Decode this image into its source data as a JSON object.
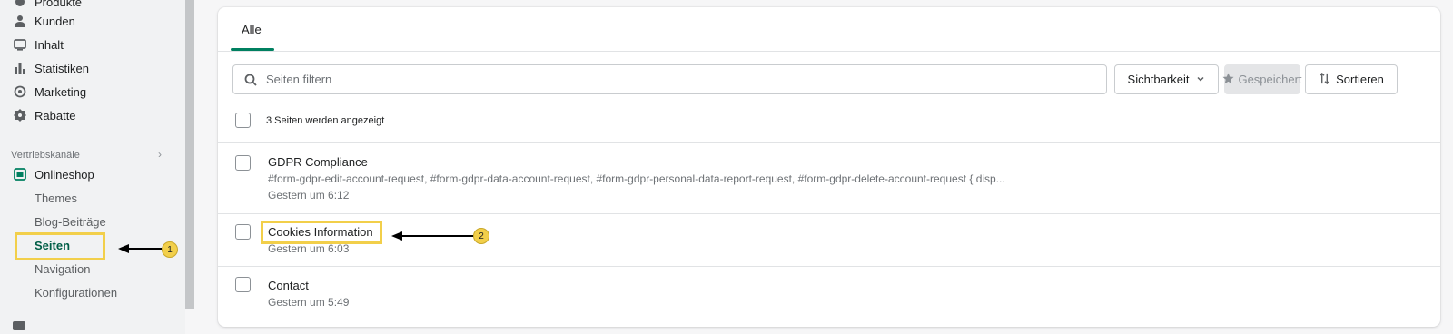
{
  "sidebar": {
    "items": [
      {
        "label": "Produkte",
        "icon": "tag-icon"
      },
      {
        "label": "Kunden",
        "icon": "person-icon"
      },
      {
        "label": "Inhalt",
        "icon": "content-icon"
      },
      {
        "label": "Statistiken",
        "icon": "bar-chart-icon"
      },
      {
        "label": "Marketing",
        "icon": "target-icon"
      },
      {
        "label": "Rabatte",
        "icon": "discount-icon"
      }
    ],
    "section_title": "Vertriebskanäle",
    "channel": {
      "label": "Onlineshop",
      "icon": "store-icon"
    },
    "sub_items": [
      "Themes",
      "Blog-Beiträge",
      "Seiten",
      "Navigation",
      "Konfigurationen"
    ]
  },
  "annotations": {
    "badge1": "1",
    "badge2": "2"
  },
  "main": {
    "tab_label": "Alle",
    "filter_placeholder": "Seiten filtern",
    "visibility_label": "Sichtbarkeit",
    "saved_label": "Gespeichert",
    "sort_label": "Sortieren",
    "count_text": "3 Seiten werden angezeigt",
    "pages": [
      {
        "title": "GDPR Compliance",
        "excerpt": "#form-gdpr-edit-account-request, #form-gdpr-data-account-request, #form-gdpr-personal-data-report-request, #form-gdpr-delete-account-request { disp...",
        "updated": "Gestern um 6:12"
      },
      {
        "title": "Cookies Information",
        "updated": "Gestern um 6:03"
      },
      {
        "title": "Contact",
        "updated": "Gestern um 5:49"
      }
    ]
  },
  "colors": {
    "accent": "#008060",
    "highlight": "#f2cf4a"
  }
}
